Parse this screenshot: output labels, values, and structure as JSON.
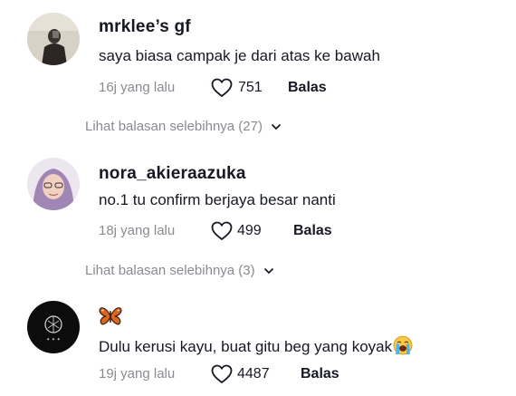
{
  "comments": [
    {
      "username": "mrklee’s  gf",
      "text": "saya biasa campak je dari atas ke bawah",
      "time": "16j yang lalu",
      "likes": "751",
      "reply_label": "Balas",
      "more_replies": "Lihat balasan selebihnya (27)"
    },
    {
      "username": "nora_akieraazuka",
      "text": "no.1 tu confirm berjaya besar nanti",
      "time": "18j yang lalu",
      "likes": "499",
      "reply_label": "Balas",
      "more_replies": "Lihat balasan selebihnya (3)"
    },
    {
      "username_icon": "butterfly-emoji",
      "text": "Dulu kerusi kayu, buat gitu beg yang koyak",
      "text_emoji": "loudly-crying-face-emoji",
      "time": "19j yang lalu",
      "likes": "4487",
      "reply_label": "Balas"
    }
  ],
  "colors": {
    "primary_text": "#161823",
    "secondary_text": "#8a8b91",
    "butterfly": "#d9651f"
  }
}
